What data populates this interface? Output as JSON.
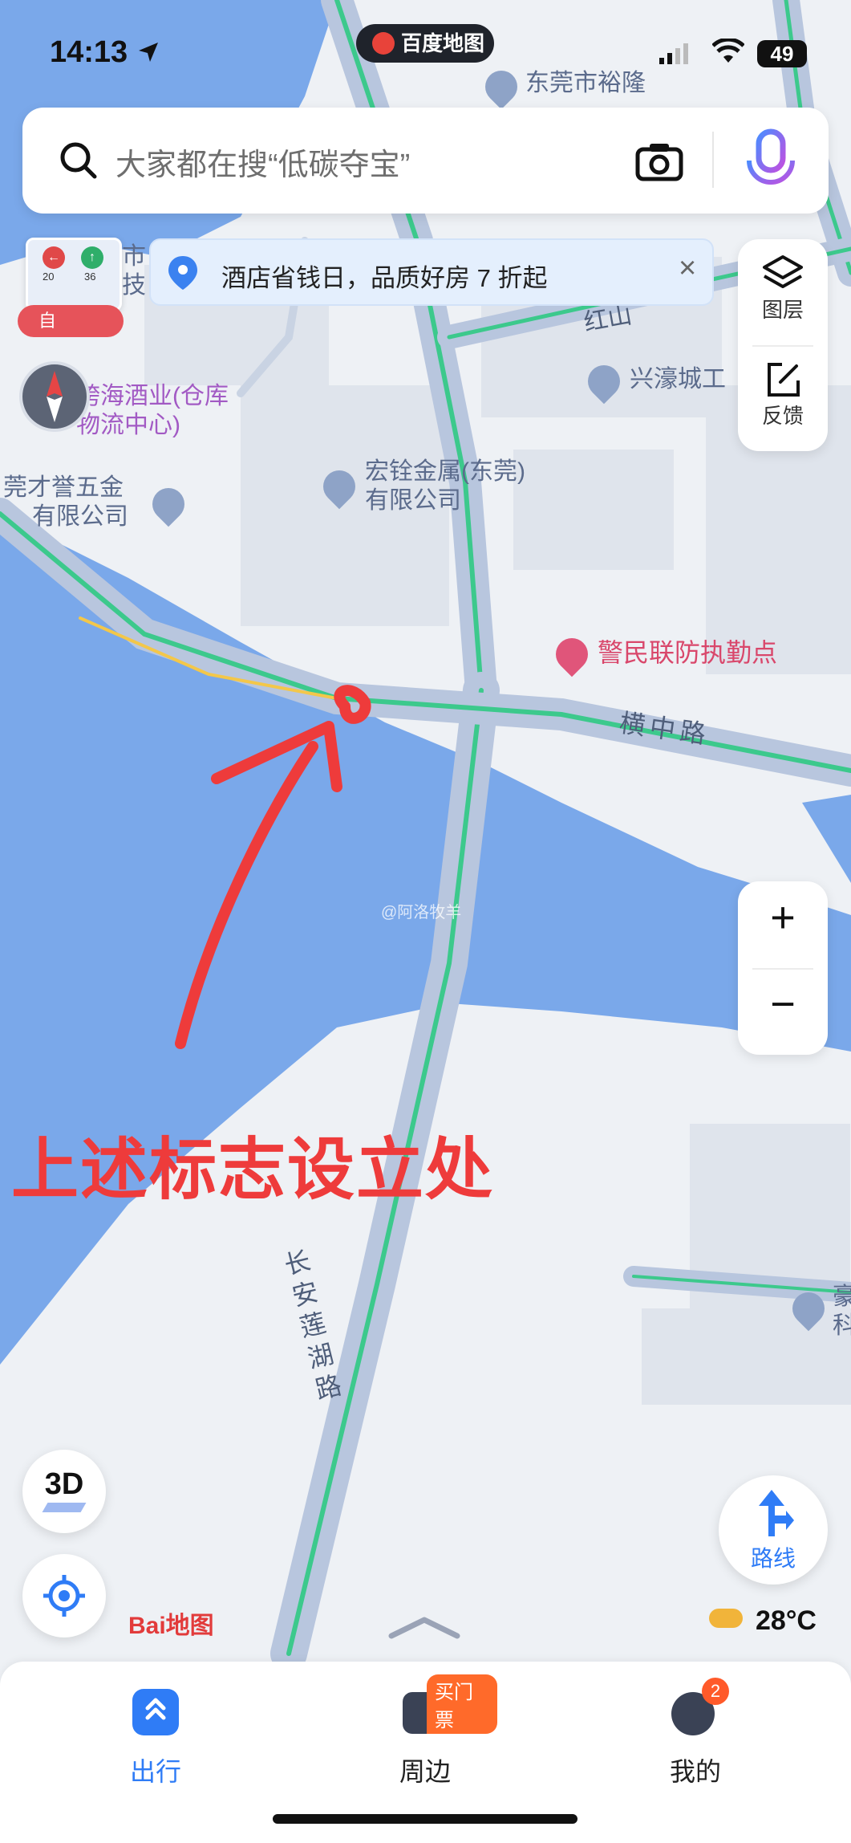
{
  "status_bar": {
    "time": "14:13",
    "app_pill": "百度地图",
    "battery": "49"
  },
  "search": {
    "placeholder": "大家都在搜“低碳夺宝”"
  },
  "promo_banner": {
    "text": "酒店省钱日，品质好房 7 折起"
  },
  "side_tools": {
    "layers_label": "图层",
    "feedback_label": "反馈"
  },
  "zoom": {
    "in": "+",
    "out": "−"
  },
  "widget": {
    "speed_left": "20",
    "speed_right": "36",
    "label": "自"
  },
  "pois": [
    {
      "name_line1": "东莞市裕隆"
    },
    {
      "name_line1": "跨海酒业(仓库",
      "name_line2": "物流中心)"
    },
    {
      "name_line1": "莞才誉五金",
      "name_line2": "有限公司"
    },
    {
      "name_line1": "宏铨金属(东莞)",
      "name_line2": "有限公司"
    },
    {
      "name_line1": "兴濠城工"
    },
    {
      "name_line1": "警民联防执勤点"
    },
    {
      "name_line1": "豪",
      "name_line2": "科"
    },
    {
      "name_line1": "市",
      "name_line2": "技"
    }
  ],
  "roads": {
    "hengzhong": "横中路",
    "changan": "长安莲湖路",
    "hongshan": "红山"
  },
  "annotation": {
    "text": "上述标志设立处"
  },
  "watermark": "@阿洛牧羊",
  "buttons": {
    "three_d": "3D",
    "route": "路线"
  },
  "brand": "Bai地图",
  "weather": {
    "temperature": "28°C"
  },
  "tabs": [
    {
      "label": "出行",
      "active": true
    },
    {
      "label": "周边",
      "badge": "买门票"
    },
    {
      "label": "我的",
      "badge": "2"
    }
  ],
  "colors": {
    "accent": "#2f7cf6",
    "road": "#b8c6de",
    "road_green": "#3cc98c",
    "water": "#7aa8ea",
    "annotation": "#ee3b3b"
  }
}
